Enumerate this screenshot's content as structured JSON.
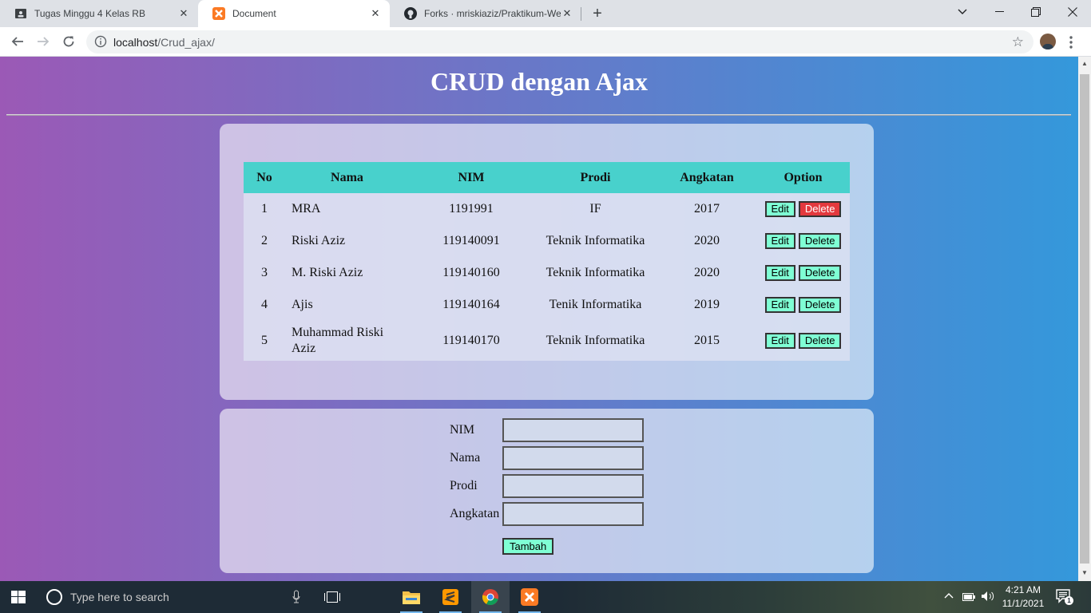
{
  "browser": {
    "tabs": [
      {
        "title": "Tugas Minggu 4 Kelas RB",
        "icon": "classroom-icon"
      },
      {
        "title": "Document",
        "icon": "xampp-icon"
      },
      {
        "title": "Forks · mriskiaziz/Praktikum-Web",
        "icon": "github-icon"
      }
    ],
    "url_host": "localhost",
    "url_path": "/Crud_ajax/"
  },
  "page": {
    "title": "CRUD dengan Ajax",
    "table": {
      "headers": [
        "No",
        "Nama",
        "NIM",
        "Prodi",
        "Angkatan",
        "Option"
      ],
      "rows": [
        {
          "no": "1",
          "nama": "MRA",
          "nim": "1191991",
          "prodi": "IF",
          "angkatan": "2017"
        },
        {
          "no": "2",
          "nama": "Riski Aziz",
          "nim": "119140091",
          "prodi": "Teknik Informatika",
          "angkatan": "2020"
        },
        {
          "no": "3",
          "nama": "M. Riski Aziz",
          "nim": "119140160",
          "prodi": "Teknik Informatika",
          "angkatan": "2020"
        },
        {
          "no": "4",
          "nama": "Ajis",
          "nim": "119140164",
          "prodi": "Tenik Informatika",
          "angkatan": "2019"
        },
        {
          "no": "5",
          "nama": "Muhammad Riski Aziz",
          "nim": "119140170",
          "prodi": "Teknik Informatika",
          "angkatan": "2015"
        }
      ],
      "edit_label": "Edit",
      "delete_label": "Delete"
    },
    "form": {
      "nim_label": "NIM",
      "nama_label": "Nama",
      "prodi_label": "Prodi",
      "angkatan_label": "Angkatan",
      "nim_value": "",
      "nama_value": "",
      "prodi_value": "",
      "angkatan_value": "",
      "submit_label": "Tambah"
    }
  },
  "taskbar": {
    "search_placeholder": "Type here to search",
    "time": "4:21 AM",
    "date": "11/1/2021",
    "notification_count": "1"
  },
  "colors": {
    "gradient_start": "#9b59b6",
    "gradient_end": "#3498db",
    "header_row": "#48d1cc",
    "button": "#7fffd4",
    "delete_active": "#e3393e"
  }
}
